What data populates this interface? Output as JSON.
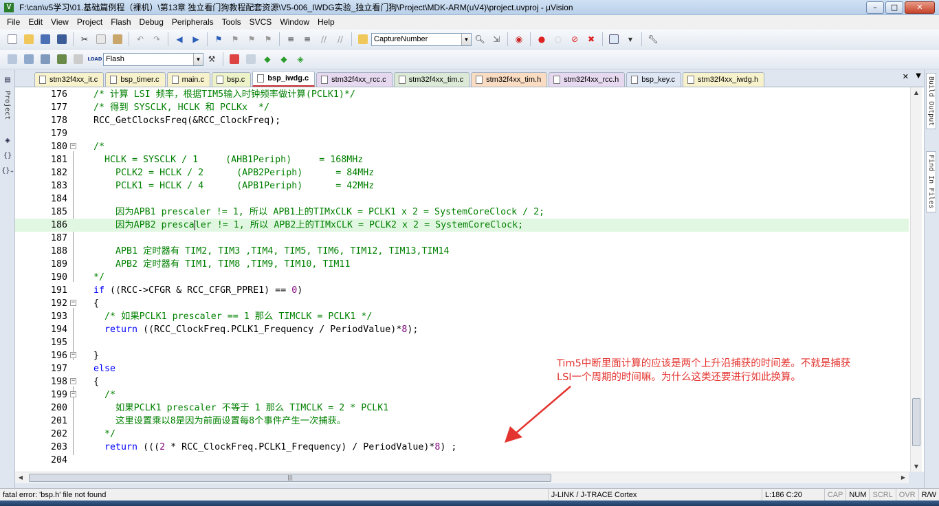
{
  "window": {
    "title": "F:\\can\\v5学习\\01.基础篇例程（裸机）\\第13章 独立看门狗教程配套资源\\V5-006_IWDG实验_独立看门狗\\Project\\MDK-ARM(uV4)\\project.uvproj - µVision",
    "app_icon": "V",
    "min": "–",
    "max": "□",
    "close": "✕"
  },
  "menu": [
    "File",
    "Edit",
    "View",
    "Project",
    "Flash",
    "Debug",
    "Peripherals",
    "Tools",
    "SVCS",
    "Window",
    "Help"
  ],
  "toolbar1": {
    "find_combo_value": "CaptureNumber"
  },
  "toolbar2": {
    "target_combo_value": "Flash",
    "load_label": "LOAD"
  },
  "left_panel": {
    "project_tab": "Project",
    "braces_label": "{}",
    "func_label": "{}₊"
  },
  "right_panel": {
    "build_output_tab": "Build Output",
    "find_in_files_tab": "Find In Files"
  },
  "tabs": [
    {
      "label": "stm32f4xx_it.c",
      "color": "#f7f2cc"
    },
    {
      "label": "bsp_timer.c",
      "color": "#f7f2cc"
    },
    {
      "label": "main.c",
      "color": "#f7f2cc"
    },
    {
      "label": "bsp.c",
      "color": "#eef2c8"
    },
    {
      "label": "bsp_iwdg.c",
      "color": "#ffffff",
      "active": true
    },
    {
      "label": "stm32f4xx_rcc.c",
      "color": "#e6d8ee"
    },
    {
      "label": "stm32f4xx_tim.c",
      "color": "#dbe9d6"
    },
    {
      "label": "stm32f4xx_tim.h",
      "color": "#f9dcc2"
    },
    {
      "label": "stm32f4xx_rcc.h",
      "color": "#e6d8ee"
    },
    {
      "label": "bsp_key.c",
      "color": "#dfe7f5"
    },
    {
      "label": "stm32f4xx_iwdg.h",
      "color": "#f7f2cc"
    }
  ],
  "tab_menu_glyph": "▼",
  "tab_close_glyph": "✕",
  "code_lines": [
    {
      "n": "176",
      "t": "/* 计算 LSI 频率，根据TIM5输入时钟频率做计算(PCLK1)*/",
      "k": "cm"
    },
    {
      "n": "177",
      "t": "/* 得到 SYSCLK, HCLK 和 PCLKx  */",
      "k": "cm"
    },
    {
      "n": "178",
      "t": "RCC_GetClocksFreq(&RCC_ClockFreq);",
      "k": "tx"
    },
    {
      "n": "179",
      "t": "",
      "k": "tx"
    },
    {
      "n": "180",
      "t": "/*",
      "k": "cm",
      "fold": "−"
    },
    {
      "n": "181",
      "t": "  HCLK = SYSCLK / 1     (AHB1Periph)     = 168MHz",
      "k": "cm"
    },
    {
      "n": "182",
      "t": "    PCLK2 = HCLK / 2      (APB2Periph)      = 84MHz",
      "k": "cm"
    },
    {
      "n": "183",
      "t": "    PCLK1 = HCLK / 4      (APB1Periph)      = 42MHz",
      "k": "cm"
    },
    {
      "n": "184",
      "t": "",
      "k": "cm"
    },
    {
      "n": "185",
      "t": "    因为APB1 prescaler != 1, 所以 APB1上的TIMxCLK = PCLK1 x 2 = SystemCoreClock / 2;",
      "k": "cm"
    },
    {
      "n": "186",
      "t": "    因为APB2 prescaler != 1, 所以 APB2上的TIMxCLK = PCLK2 x 2 = SystemCoreClock;",
      "k": "cm",
      "hl": true
    },
    {
      "n": "187",
      "t": "",
      "k": "cm"
    },
    {
      "n": "188",
      "t": "    APB1 定时器有 TIM2, TIM3 ,TIM4, TIM5, TIM6, TIM12, TIM13,TIM14",
      "k": "cm"
    },
    {
      "n": "189",
      "t": "    APB2 定时器有 TIM1, TIM8 ,TIM9, TIM10, TIM11",
      "k": "cm"
    },
    {
      "n": "190",
      "t": "*/",
      "k": "cm"
    },
    {
      "n": "191",
      "t": "if ((RCC->CFGR & RCC_CFGR_PPRE1) == 0)",
      "k": "mix",
      "parts": [
        [
          "kw",
          "if"
        ],
        [
          "tx",
          " ((RCC->CFGR & RCC_CFGR_PPRE1) == "
        ],
        [
          "nm",
          "0"
        ],
        [
          "tx",
          ")"
        ]
      ]
    },
    {
      "n": "192",
      "t": "{",
      "k": "tx",
      "fold": "−"
    },
    {
      "n": "193",
      "t": "  /* 如果PCLK1 prescaler == 1 那么 TIMCLK = PCLK1 */",
      "k": "cm"
    },
    {
      "n": "194",
      "t": "  return ((RCC_ClockFreq.PCLK1_Frequency / PeriodValue)*8);",
      "k": "mix",
      "parts": [
        [
          "tx",
          "  "
        ],
        [
          "kw",
          "return"
        ],
        [
          "tx",
          " ((RCC_ClockFreq.PCLK1_Frequency / PeriodValue)*"
        ],
        [
          "nm",
          "8"
        ],
        [
          "tx",
          ");"
        ]
      ]
    },
    {
      "n": "195",
      "t": "",
      "k": "tx"
    },
    {
      "n": "196",
      "t": "}",
      "k": "tx",
      "fold": "−"
    },
    {
      "n": "197",
      "t": "else",
      "k": "kw"
    },
    {
      "n": "198",
      "t": "{",
      "k": "tx",
      "fold": "−"
    },
    {
      "n": "199",
      "t": "  /*",
      "k": "cm",
      "fold": "−"
    },
    {
      "n": "200",
      "t": "    如果PCLK1 prescaler 不等于 1 那么 TIMCLK = 2 * PCLK1",
      "k": "cm"
    },
    {
      "n": "201",
      "t": "    这里设置乘以8是因为前面设置每8个事件产生一次捕获。",
      "k": "cm"
    },
    {
      "n": "202",
      "t": "  */",
      "k": "cm"
    },
    {
      "n": "203",
      "t": "  return (((2 * RCC_ClockFreq.PCLK1_Frequency) / PeriodValue)*8) ;",
      "k": "mix",
      "parts": [
        [
          "tx",
          "  "
        ],
        [
          "kw",
          "return"
        ],
        [
          "tx",
          " ((("
        ],
        [
          "nm",
          "2"
        ],
        [
          "tx",
          " * RCC_ClockFreq.PCLK1_Frequency) / PeriodValue)*"
        ],
        [
          "nm",
          "8"
        ],
        [
          "tx",
          ") ;"
        ]
      ]
    },
    {
      "n": "204",
      "t": "",
      "k": "tx"
    }
  ],
  "annotation": {
    "line1": "Tim5中断里面计算的应该是两个上升沿捕获的时间差。不就是捕获",
    "line2": "LSI一个周期的时间嘛。为什么这类还要进行如此换算。",
    "color": "#e3342f"
  },
  "status": {
    "message": "fatal error: 'bsp.h' file not found",
    "debugger": "J-LINK / J-TRACE Cortex",
    "position": "L:186 C:20",
    "caps": "CAP",
    "num": "NUM",
    "scrl": "SCRL",
    "ovr": "OVR",
    "rw": "R/W"
  },
  "colors": {
    "comment": "#008000",
    "keyword": "#0000ff",
    "number": "#7f007f",
    "highlight_line": "#e2f7e2"
  }
}
